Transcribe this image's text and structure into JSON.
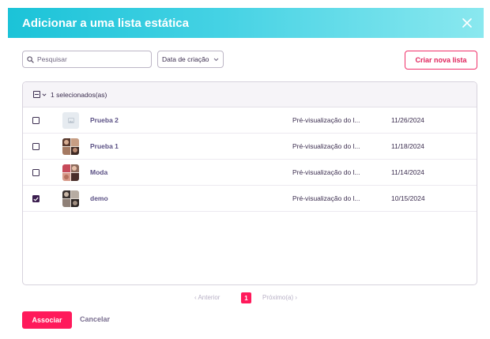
{
  "dialog": {
    "title": "Adicionar a uma lista estática",
    "close_icon": "close-icon"
  },
  "toolbar": {
    "search_placeholder": "Pesquisar",
    "sort_label": "Data de criação",
    "create_label": "Criar nova lista"
  },
  "table": {
    "selected_count": "1 selecionados(as)",
    "rows": [
      {
        "name": "Prueba 2",
        "preview": "Pré-visualização do l...",
        "date": "11/26/2024",
        "checked": false,
        "thumb": "image-placeholder-icon"
      },
      {
        "name": "Prueba 1",
        "preview": "Pré-visualização do l...",
        "date": "11/18/2024",
        "checked": false,
        "thumb": "photo-collage"
      },
      {
        "name": "Moda",
        "preview": "Pré-visualização do l...",
        "date": "11/14/2024",
        "checked": false,
        "thumb": "photo-collage"
      },
      {
        "name": "demo",
        "preview": "Pré-visualização do l...",
        "date": "10/15/2024",
        "checked": true,
        "thumb": "photo-collage"
      }
    ]
  },
  "pagination": {
    "prev_label": "Anterior",
    "current_page": "1",
    "next_label": "Próximo(a)"
  },
  "footer": {
    "associate_label": "Associar",
    "cancel_label": "Cancelar"
  },
  "colors": {
    "header_gradient_start": "#1bc3d8",
    "header_gradient_end": "#8ae8ef",
    "primary": "#ff1a5b",
    "text_dark": "#3b2d4f",
    "link_purple": "#5b5185"
  }
}
